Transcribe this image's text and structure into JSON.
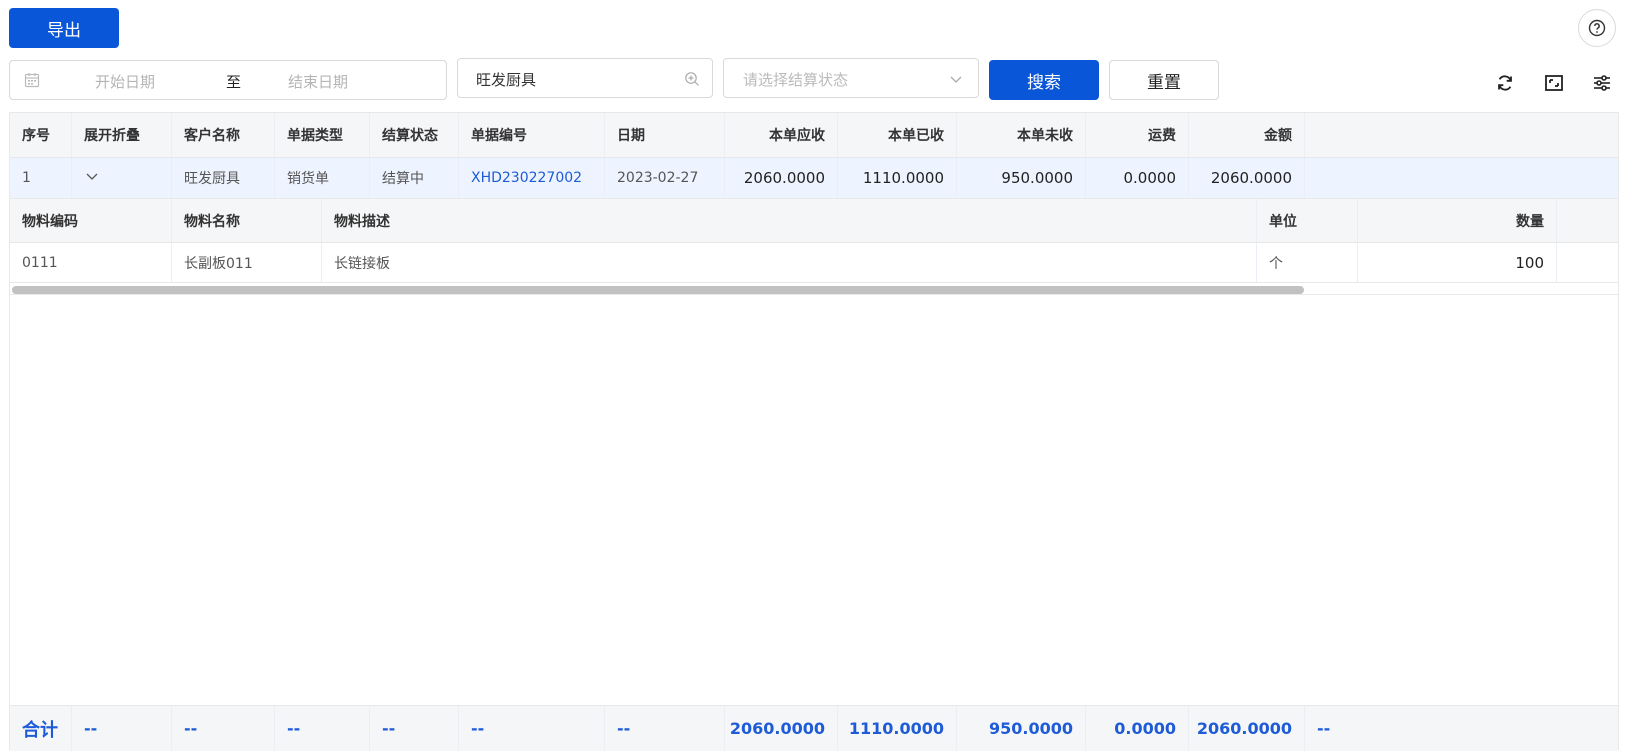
{
  "toolbar": {
    "export_label": "导出",
    "search_label": "搜索",
    "reset_label": "重置"
  },
  "filters": {
    "start_date_placeholder": "开始日期",
    "range_separator": "至",
    "end_date_placeholder": "结束日期",
    "customer_value": "旺发厨具",
    "status_placeholder": "请选择结算状态"
  },
  "icons": {
    "help": "question-circle-icon",
    "calendar": "calendar-icon",
    "customer_search": "zoom-in-icon",
    "status_dropdown": "chevron-down-icon",
    "refresh": "refresh-icon",
    "fullscreen": "fullscreen-icon",
    "settings": "sliders-icon",
    "expand": "chevron-down-icon"
  },
  "colors": {
    "primary": "#0a56d8",
    "link": "#1e5bd6",
    "row_highlight": "#eef4ff",
    "header_bg": "#f5f6f8"
  },
  "table": {
    "columns": [
      "序号",
      "展开折叠",
      "客户名称",
      "单据类型",
      "结算状态",
      "单据编号",
      "日期",
      "本单应收",
      "本单已收",
      "本单未收",
      "运费",
      "金额"
    ],
    "rows": [
      {
        "index": "1",
        "customer": "旺发厨具",
        "doc_type": "销货单",
        "status": "结算中",
        "doc_no": "XHD230227002",
        "date": "2023-02-27",
        "receivable": "2060.0000",
        "received": "1110.0000",
        "unreceived": "950.0000",
        "freight": "0.0000",
        "amount": "2060.0000"
      }
    ],
    "detail": {
      "columns": [
        "物料编码",
        "物料名称",
        "物料描述",
        "单位",
        "数量"
      ],
      "rows": [
        {
          "code": "0111",
          "name": "长副板011",
          "desc": "长链接板",
          "unit": "个",
          "qty": "100"
        }
      ]
    },
    "summary": {
      "label": "合计",
      "placeholder": "--",
      "receivable": "2060.0000",
      "received": "1110.0000",
      "unreceived": "950.0000",
      "freight": "0.0000",
      "amount": "2060.0000"
    }
  }
}
